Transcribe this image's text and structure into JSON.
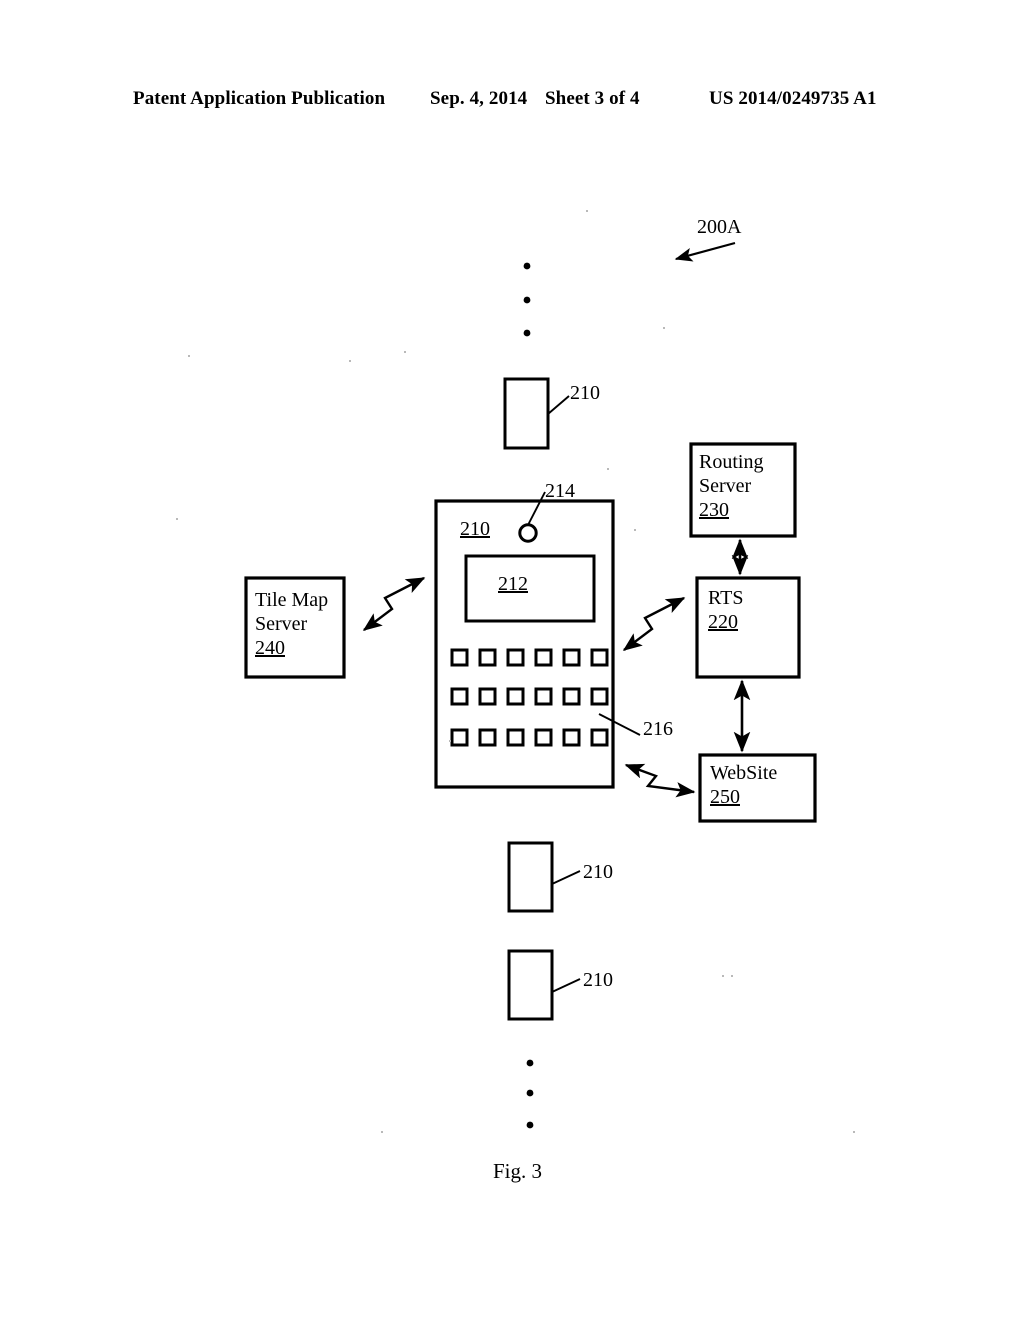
{
  "header": {
    "publication": "Patent Application Publication",
    "date": "Sep. 4, 2014",
    "sheet": "Sheet 3 of 4",
    "number": "US 2014/0249735 A1"
  },
  "figure": {
    "caption": "Fig. 3",
    "system_label": "200A",
    "labels": {
      "device_top_ref": "210",
      "device_main_ref": "210",
      "speaker_ref": "214",
      "keypad_ref": "216",
      "device_bottom1_ref": "210",
      "device_bottom2_ref": "210"
    },
    "nodes": {
      "routing_server": {
        "line1": "Routing",
        "line2": "Server",
        "number": "230"
      },
      "rts": {
        "line1": "RTS",
        "number": "220"
      },
      "website": {
        "line1": "WebSite",
        "number": "250"
      },
      "tile_map_server": {
        "line1": "Tile  Map",
        "line2": "Server",
        "number": "240"
      },
      "screen": {
        "number": "212"
      }
    },
    "keypad": {
      "rows": 3,
      "columns": 6
    },
    "ellipsis_dots": 3,
    "colors": {
      "ink": "#000000",
      "paper": "#ffffff"
    }
  }
}
